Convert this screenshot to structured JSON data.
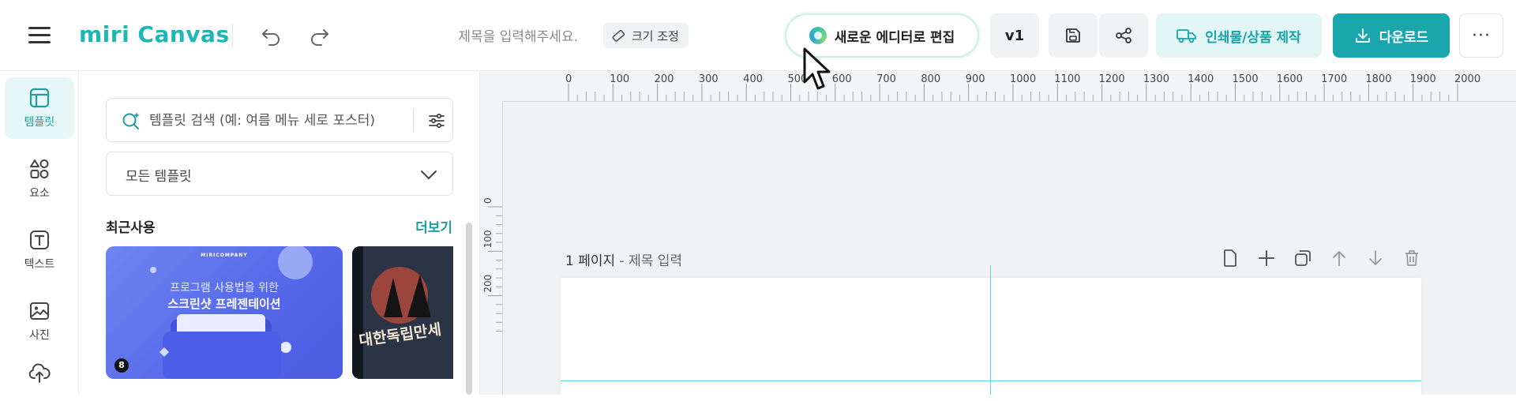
{
  "header": {
    "logo": "miri Canvas",
    "title_placeholder": "제목을 입력해주세요.",
    "resize_label": "크기 조정",
    "new_editor_label": "새로운 에디터로 편집",
    "version_label": "v1",
    "print_label": "인쇄물/상품 제작",
    "download_label": "다운로드",
    "more_label": "···"
  },
  "sidebar": {
    "items": [
      {
        "label": "템플릿",
        "icon": "template-icon",
        "active": true
      },
      {
        "label": "요소",
        "icon": "elements-icon",
        "active": false
      },
      {
        "label": "텍스트",
        "icon": "text-icon",
        "active": false
      },
      {
        "label": "사진",
        "icon": "photo-icon",
        "active": false
      },
      {
        "label": "",
        "icon": "upload-icon",
        "active": false
      }
    ]
  },
  "panel": {
    "search_placeholder": "템플릿 검색 (예: 여름 메뉴 세로 포스터)",
    "category_value": "모든 템플릿",
    "recent_title": "최근사용",
    "more_link": "더보기",
    "thumb1": {
      "brand": "MIRICOMPANY",
      "line1": "프로그램 사용법을 위한",
      "line2": "스크린샷 프레젠테이션",
      "badge": "8"
    },
    "thumb2": {
      "title": "대한독립만세"
    }
  },
  "canvas": {
    "ruler_ticks": [
      "0",
      "100",
      "200",
      "300",
      "400",
      "500",
      "600",
      "700",
      "800",
      "900",
      "1000",
      "1100",
      "1200",
      "1300",
      "1400",
      "1500",
      "1600",
      "1700",
      "1800",
      "1900",
      "2000"
    ],
    "v_ruler_ticks": [
      "0",
      "100",
      "200"
    ],
    "page_number_label": "1 페이지",
    "page_title_separator": " - ",
    "page_title_placeholder": "제목 입력"
  },
  "colors": {
    "brand": "#1fb6b6",
    "download_bg": "#19a6ad",
    "print_bg": "#e3f6f6",
    "guide": "#62d6dd"
  }
}
